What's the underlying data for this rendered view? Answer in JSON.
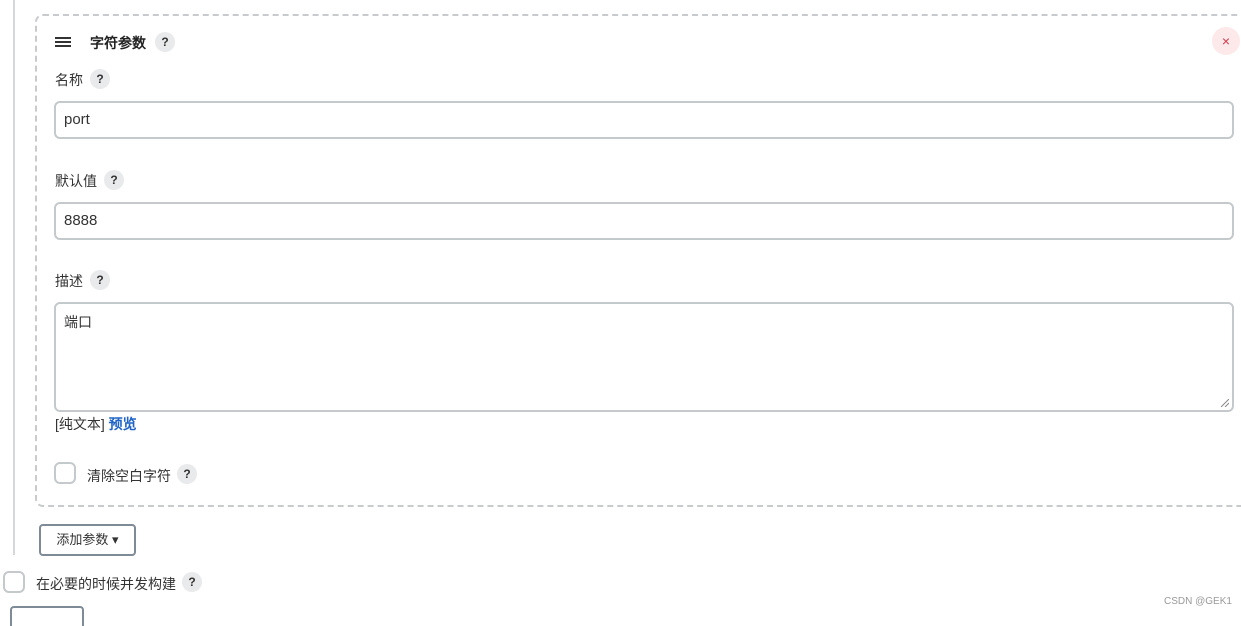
{
  "param_card": {
    "title": "字符参数",
    "delete_glyph": "×",
    "name_field": {
      "label": "名称",
      "value": "port"
    },
    "default_field": {
      "label": "默认值",
      "value": "8888"
    },
    "description_field": {
      "label": "描述",
      "value": "端口"
    },
    "format": {
      "plain_text": "[纯文本]",
      "preview": "预览"
    },
    "trim": {
      "label": "清除空白字符",
      "checked": false
    }
  },
  "help_glyph": "?",
  "add_param_button": {
    "label": "添加参数",
    "caret": "▾"
  },
  "concurrent_build": {
    "label": "在必要的时候并发构建",
    "checked": false
  },
  "watermark": "CSDN @GEK1",
  "icons": [
    "drag-handle-icon",
    "help-icon",
    "close-icon",
    "chevron-down-icon",
    "resize-grip-icon"
  ],
  "colors": {
    "link": "#1e63c5",
    "delete": "#d33a4a",
    "delete_bg": "#fde8ea",
    "border": "#c4c9cc"
  }
}
